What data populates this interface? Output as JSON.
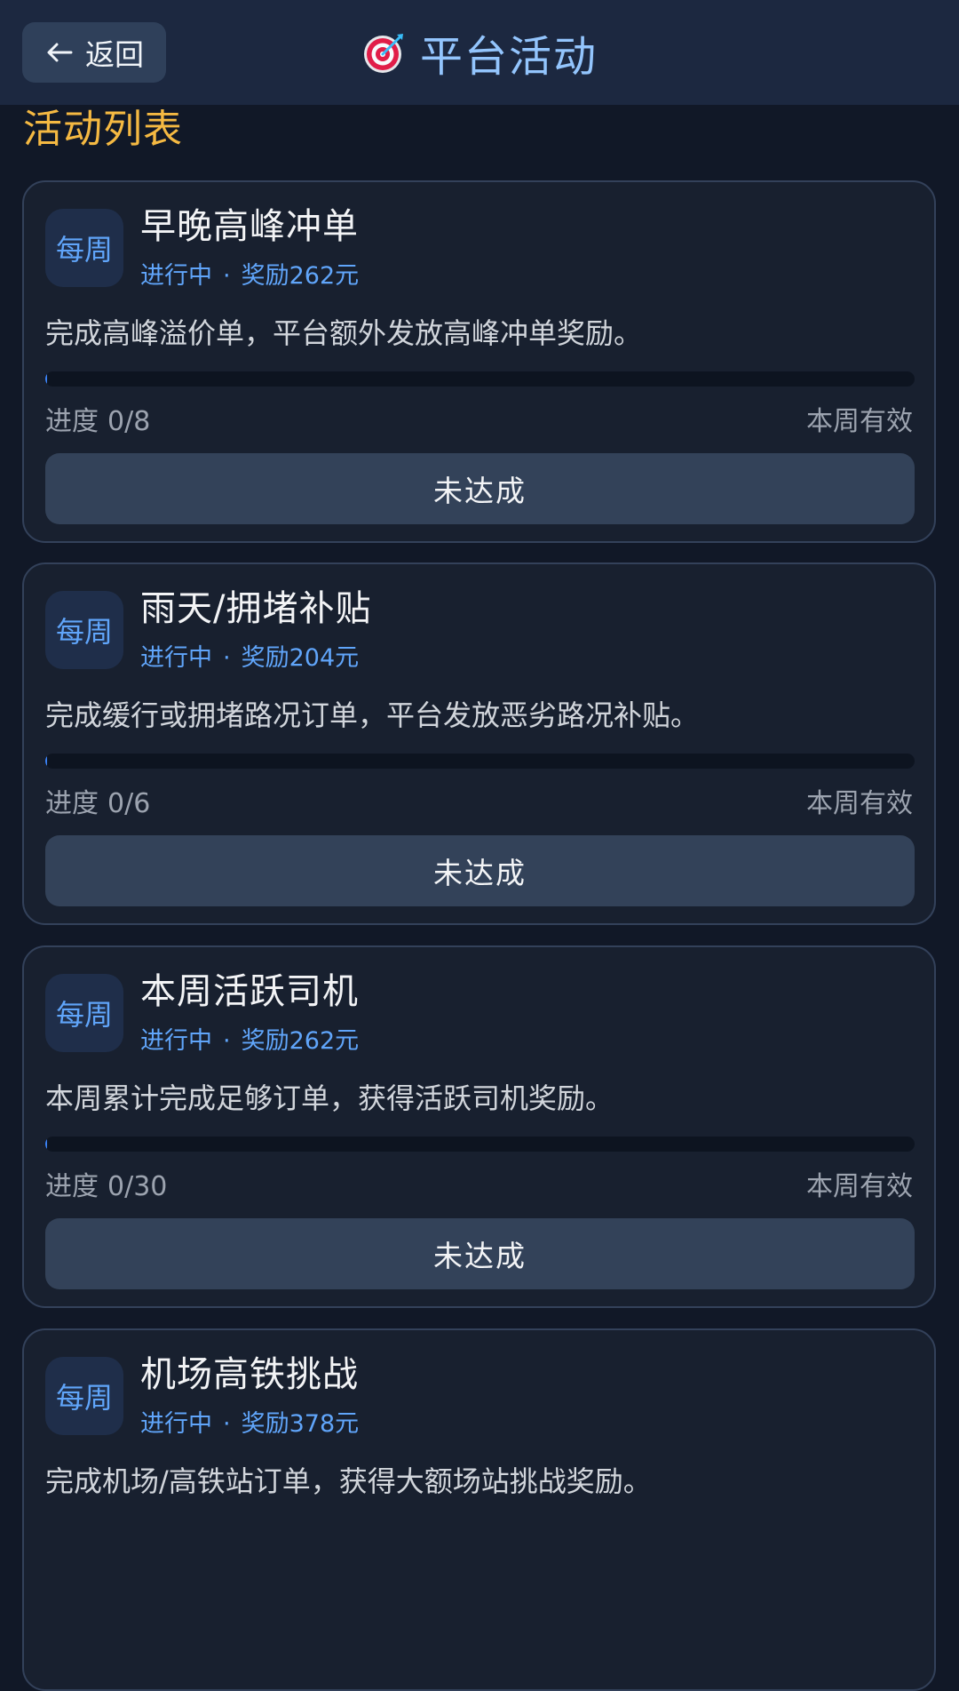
{
  "header": {
    "back_label": "返回",
    "title": "平台活动"
  },
  "section_title": "活动列表",
  "cards": [
    {
      "badge": "每周",
      "title": "早晚高峰冲单",
      "status": "进行中",
      "separator": "·",
      "reward": "奖励262元",
      "description": "完成高峰溢价单，平台额外发放高峰冲单奖励。",
      "progress_label": "进度",
      "progress_text": "0/8",
      "progress_fraction": 0,
      "validity": "本周有效",
      "button": "未达成"
    },
    {
      "badge": "每周",
      "title": "雨天/拥堵补贴",
      "status": "进行中",
      "separator": "·",
      "reward": "奖励204元",
      "description": "完成缓行或拥堵路况订单，平台发放恶劣路况补贴。",
      "progress_label": "进度",
      "progress_text": "0/6",
      "progress_fraction": 0,
      "validity": "本周有效",
      "button": "未达成"
    },
    {
      "badge": "每周",
      "title": "本周活跃司机",
      "status": "进行中",
      "separator": "·",
      "reward": "奖励262元",
      "description": "本周累计完成足够订单，获得活跃司机奖励。",
      "progress_label": "进度",
      "progress_text": "0/30",
      "progress_fraction": 0,
      "validity": "本周有效",
      "button": "未达成"
    },
    {
      "badge": "每周",
      "title": "机场高铁挑战",
      "status": "进行中",
      "separator": "·",
      "reward": "奖励378元",
      "description": "完成机场/高铁站订单，获得大额场站挑战奖励。",
      "progress_label": "进度",
      "progress_text": "",
      "progress_fraction": 0,
      "validity": "",
      "button": ""
    }
  ],
  "colors": {
    "accent": "#60a5fa",
    "section_title": "#f5b942",
    "background": "#111827"
  },
  "icons": {
    "back": "arrow-left-icon",
    "title": "target-icon"
  }
}
